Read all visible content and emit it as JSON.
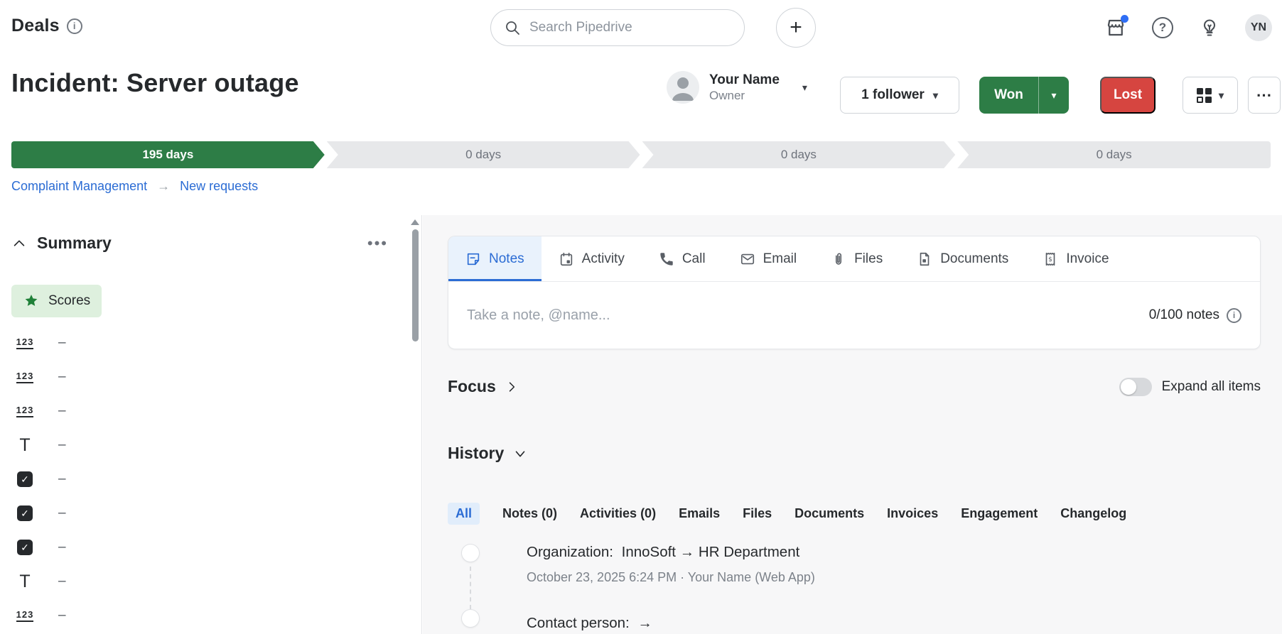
{
  "colors": {
    "accent_green": "#2d7d46",
    "accent_red": "#d64540",
    "accent_blue": "#2b6cd4",
    "scores_bg": "#def0de"
  },
  "topbar": {
    "app_title": "Deals",
    "search_placeholder": "Search Pipedrive",
    "avatar_initials": "YN"
  },
  "deal_header": {
    "title": "Incident: Server outage",
    "owner_name": "Your Name",
    "owner_role": "Owner",
    "followers_label": "1 follower",
    "won_label": "Won",
    "lost_label": "Lost",
    "more_label": "..."
  },
  "pipeline": {
    "stages": [
      {
        "label": "195 days",
        "active": true
      },
      {
        "label": "0 days",
        "active": false
      },
      {
        "label": "0 days",
        "active": false
      },
      {
        "label": "0 days",
        "active": false
      }
    ],
    "breadcrumb": {
      "pipeline": "Complaint Management",
      "separator": "→",
      "stage": "New requests"
    }
  },
  "sidebar": {
    "section_title": "Summary",
    "more_label": "...",
    "scores_label": "Scores",
    "fields": [
      {
        "type": "numeric",
        "icon": "numeric-field-icon",
        "value": "–"
      },
      {
        "type": "numeric",
        "icon": "numeric-field-icon",
        "value": "–"
      },
      {
        "type": "numeric",
        "icon": "numeric-field-icon",
        "value": "–"
      },
      {
        "type": "text",
        "icon": "text-field-icon",
        "value": "–"
      },
      {
        "type": "checkbox",
        "icon": "checkbox-field-icon",
        "value": "–"
      },
      {
        "type": "checkbox",
        "icon": "checkbox-field-icon",
        "value": "–"
      },
      {
        "type": "checkbox",
        "icon": "checkbox-field-icon",
        "value": "–"
      },
      {
        "type": "text",
        "icon": "text-field-icon",
        "value": "–"
      },
      {
        "type": "numeric",
        "icon": "numeric-field-icon",
        "value": "–"
      }
    ]
  },
  "main": {
    "tabs": [
      {
        "label": "Notes",
        "icon": "note-icon",
        "active": true
      },
      {
        "label": "Activity",
        "icon": "calendar-icon",
        "active": false
      },
      {
        "label": "Call",
        "icon": "phone-icon",
        "active": false
      },
      {
        "label": "Email",
        "icon": "envelope-icon",
        "active": false
      },
      {
        "label": "Files",
        "icon": "paperclip-icon",
        "active": false
      },
      {
        "label": "Documents",
        "icon": "document-icon",
        "active": false
      },
      {
        "label": "Invoice",
        "icon": "invoice-icon",
        "active": false
      }
    ],
    "note_input": {
      "placeholder": "Take a note, @name...",
      "counter": "0/100 notes"
    },
    "focus_title": "Focus",
    "expand_toggle_label": "Expand all items",
    "history": {
      "title": "History",
      "filters": [
        {
          "label": "All",
          "active": true
        },
        {
          "label": "Notes (0)",
          "active": false
        },
        {
          "label": "Activities (0)",
          "active": false
        },
        {
          "label": "Emails",
          "active": false
        },
        {
          "label": "Files",
          "active": false
        },
        {
          "label": "Documents",
          "active": false
        },
        {
          "label": "Invoices",
          "active": false
        },
        {
          "label": "Engagement",
          "active": false
        },
        {
          "label": "Changelog",
          "active": false
        }
      ],
      "entries": [
        {
          "label": "Organization:",
          "value": "InnoSoft → HR Department",
          "meta": "October 23, 2025 6:24 PM · Your Name (Web App)"
        },
        {
          "label": "Contact person:",
          "value": "→",
          "meta": ""
        }
      ]
    }
  }
}
